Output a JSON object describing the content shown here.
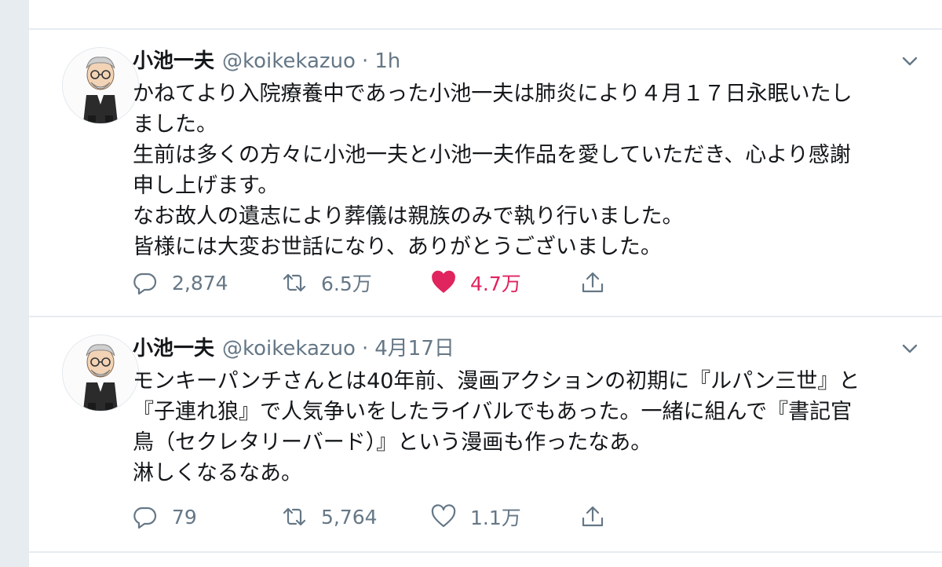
{
  "tweets": [
    {
      "display_name": "小池一夫",
      "handle": "@koikekazuo",
      "separator": "·",
      "time": "1h",
      "lines": [
        "かねてより入院療養中であった小池一夫は肺炎により４月１７日永眠いたし",
        "ました。",
        "生前は多くの方々に小池一夫と小池一夫作品を愛していただき、心より感謝",
        "申し上げます。",
        "なお故人の遺志により葬儀は親族のみで執り行いました。",
        "皆様には大変お世話になり、ありがとうございました。"
      ],
      "replies": "2,874",
      "retweets": "6.5万",
      "likes": "4.7万",
      "liked": true,
      "like_color": "#e0245e"
    },
    {
      "display_name": "小池一夫",
      "handle": "@koikekazuo",
      "separator": "·",
      "time": "4月17日",
      "lines": [
        "モンキーパンチさんとは40年前、漫画アクションの初期に『ルパン三世』と",
        "『子連れ狼』で人気争いをしたライバルでもあった。一緒に組んで『書記官",
        "鳥（セクレタリーバード）』という漫画も作ったなあ。",
        "淋しくなるなあ。"
      ],
      "replies": "79",
      "retweets": "5,764",
      "likes": "1.1万",
      "liked": false
    }
  ],
  "icons": {
    "reply": "reply-icon",
    "retweet": "retweet-icon",
    "like": "heart-icon",
    "share": "share-icon",
    "caret": "chevron-down-icon"
  },
  "colors": {
    "text": "#14171a",
    "secondary": "#657786",
    "divider": "#e6ecf0"
  }
}
